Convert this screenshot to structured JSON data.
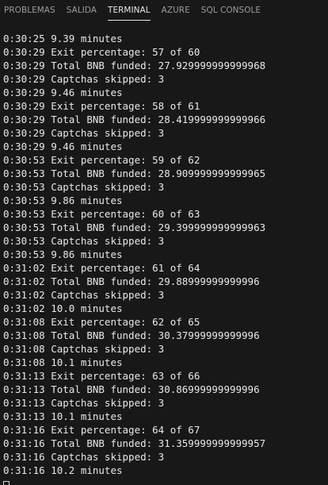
{
  "tabs": [
    {
      "id": "problems",
      "label": "PROBLEMAS",
      "active": false
    },
    {
      "id": "output",
      "label": "SALIDA",
      "active": false
    },
    {
      "id": "terminal",
      "label": "TERMINAL",
      "active": true
    },
    {
      "id": "azure",
      "label": "AZURE",
      "active": false
    },
    {
      "id": "sql-console",
      "label": "SQL CONSOLE",
      "active": false
    }
  ],
  "terminal": {
    "lines": [
      "0:30:25 9.39 minutes",
      "0:30:29 Exit percentage: 57 of 60",
      "0:30:29 Total BNB funded: 27.929999999999968",
      "0:30:29 Captchas skipped: 3",
      "0:30:29 9.46 minutes",
      "0:30:29 Exit percentage: 58 of 61",
      "0:30:29 Total BNB funded: 28.419999999999966",
      "0:30:29 Captchas skipped: 3",
      "0:30:29 9.46 minutes",
      "0:30:53 Exit percentage: 59 of 62",
      "0:30:53 Total BNB funded: 28.909999999999965",
      "0:30:53 Captchas skipped: 3",
      "0:30:53 9.86 minutes",
      "0:30:53 Exit percentage: 60 of 63",
      "0:30:53 Total BNB funded: 29.399999999999963",
      "0:30:53 Captchas skipped: 3",
      "0:30:53 9.86 minutes",
      "0:31:02 Exit percentage: 61 of 64",
      "0:31:02 Total BNB funded: 29.88999999999996",
      "0:31:02 Captchas skipped: 3",
      "0:31:02 10.0 minutes",
      "0:31:08 Exit percentage: 62 of 65",
      "0:31:08 Total BNB funded: 30.37999999999996",
      "0:31:08 Captchas skipped: 3",
      "0:31:08 10.1 minutes",
      "0:31:13 Exit percentage: 63 of 66",
      "0:31:13 Total BNB funded: 30.86999999999996",
      "0:31:13 Captchas skipped: 3",
      "0:31:13 10.1 minutes",
      "0:31:16 Exit percentage: 64 of 67",
      "0:31:16 Total BNB funded: 31.359999999999957",
      "0:31:16 Captchas skipped: 3",
      "0:31:16 10.2 minutes"
    ]
  }
}
